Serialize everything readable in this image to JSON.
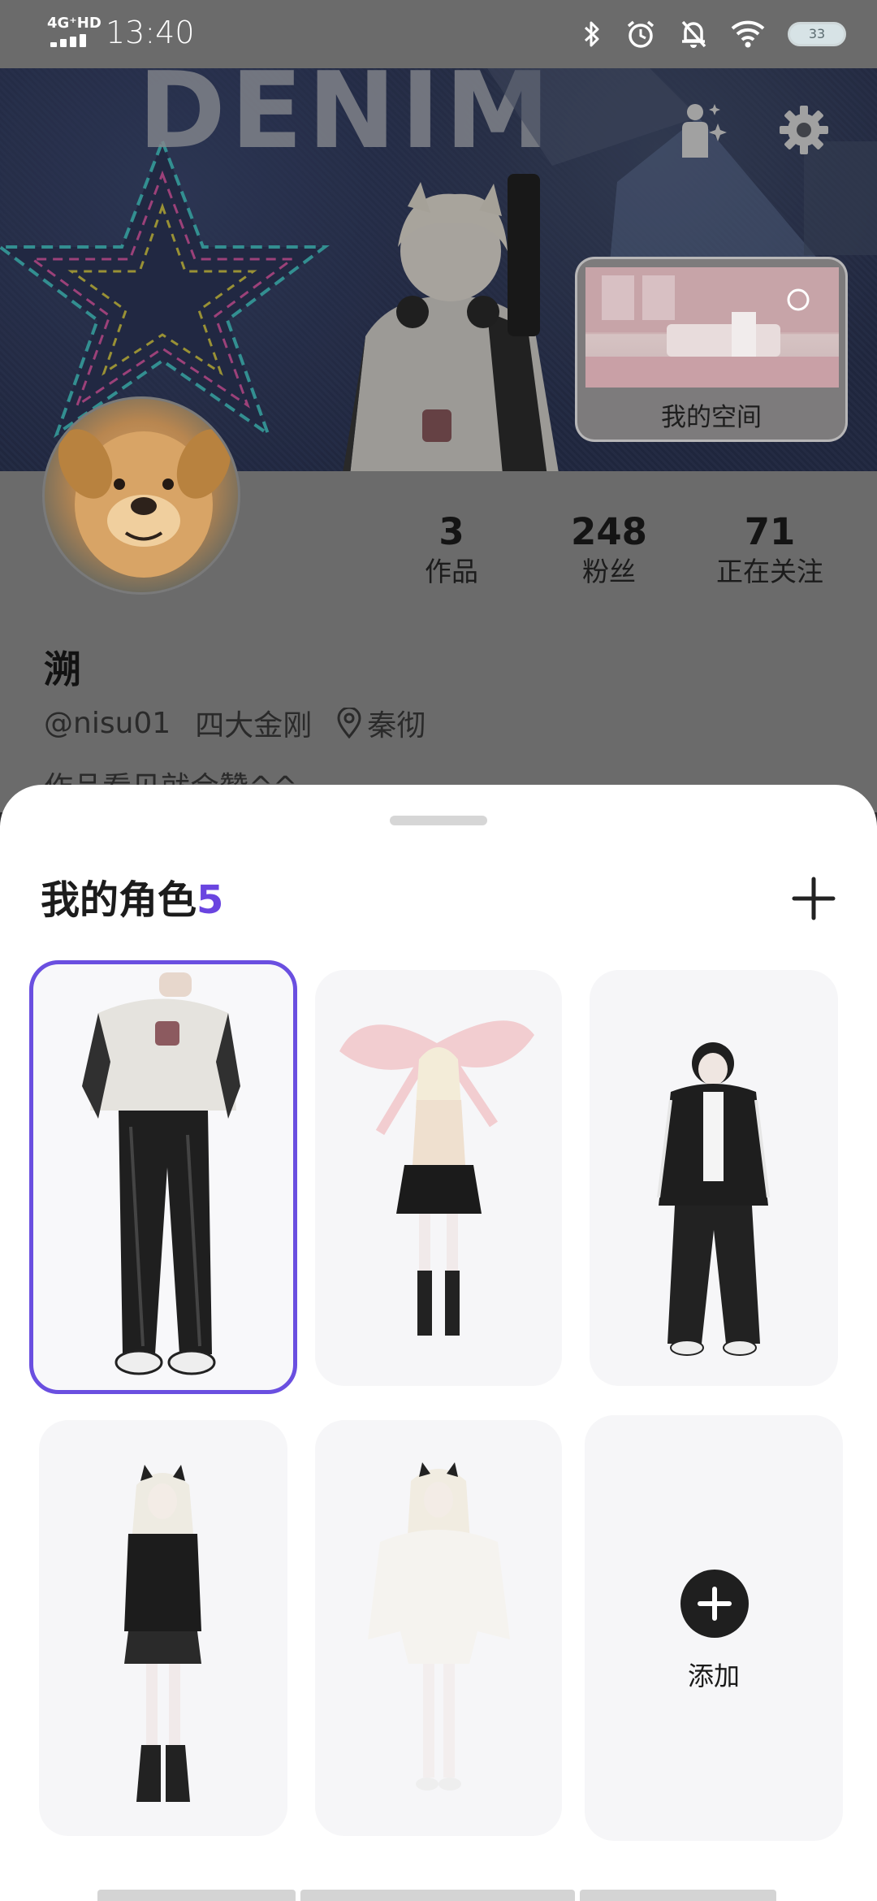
{
  "status_bar": {
    "network": "4G⁺HD",
    "time": "13:40",
    "battery": "33",
    "icons": [
      "bluetooth-icon",
      "alarm-icon",
      "mute-icon",
      "wifi-icon",
      "battery-icon"
    ]
  },
  "banner": {
    "word": "DENIM",
    "room_label": "我的空间",
    "icons": [
      "avatar-sparkle-icon",
      "gear-icon"
    ]
  },
  "profile": {
    "stats": [
      {
        "value": "3",
        "label": "作品"
      },
      {
        "value": "248",
        "label": "粉丝"
      },
      {
        "value": "71",
        "label": "正在关注"
      }
    ],
    "name": "溯",
    "handle": "@nisu01",
    "group": "四大金刚",
    "location": "秦彻",
    "bio": "作品看见就会赞^^"
  },
  "sheet": {
    "title": "我的角色",
    "count": "5",
    "add_label": "添加"
  },
  "colors": {
    "accent": "#6a45e0",
    "dim_overlay": "#6b6b6b",
    "sheet_bg": "#ffffff",
    "card_bg": "#f6f6f8"
  }
}
